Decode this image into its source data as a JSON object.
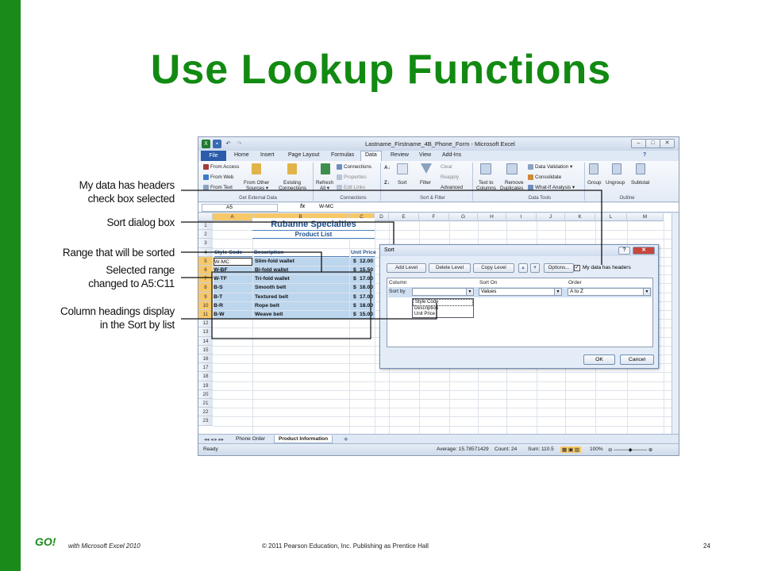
{
  "slide": {
    "title": "Use Lookup Functions",
    "footer_brand": "GO!",
    "footer_series": "with Microsoft Excel 2010",
    "footer_copyright": "© 2011 Pearson Education, Inc. Publishing as Prentice Hall",
    "page_number": "24"
  },
  "callouts": [
    {
      "line1": "My data has headers",
      "line2": "check box selected"
    },
    {
      "line1": "Sort dialog box",
      "line2": ""
    },
    {
      "line1": "Range that will be sorted",
      "line2": ""
    },
    {
      "line1": "Selected range",
      "line2": "changed to A5:C11"
    },
    {
      "line1": "Column headings display",
      "line2": "in the Sort by list"
    }
  ],
  "excel": {
    "window_title": "Lastname_Firstname_4B_Phone_Form - Microsoft Excel",
    "window_buttons": [
      "–",
      "□",
      "✕"
    ],
    "tabs": [
      "File",
      "Home",
      "Insert",
      "Page Layout",
      "Formulas",
      "Data",
      "Review",
      "View",
      "Add-Ins"
    ],
    "active_tab": "Data",
    "ribbon": {
      "get_external_data": {
        "label": "Get External Data",
        "from_access": "From Access",
        "from_web": "From Web",
        "from_text": "From Text",
        "from_other_1": "From Other",
        "from_other_2": "Sources ▾",
        "existing_1": "Existing",
        "existing_2": "Connections"
      },
      "connections": {
        "label": "Connections",
        "refresh_1": "Refresh",
        "refresh_2": "All ▾",
        "connections": "Connections",
        "properties": "Properties",
        "edit_links": "Edit Links"
      },
      "sort_filter": {
        "label": "Sort & Filter",
        "sort": "Sort",
        "filter": "Filter",
        "clear": "Clear",
        "reapply": "Reapply",
        "advanced": "Advanced"
      },
      "data_tools": {
        "label": "Data Tools",
        "text_to_1": "Text to",
        "text_to_2": "Columns",
        "remove_1": "Remove",
        "remove_2": "Duplicates",
        "validation": "Data Validation ▾",
        "consolidate": "Consolidate",
        "what_if": "What-If Analysis ▾"
      },
      "outline": {
        "label": "Outline",
        "group": "Group",
        "ungroup": "Ungroup",
        "subtotal": "Subtotal"
      }
    },
    "name_box": "A5",
    "fx": "fx",
    "formula_value": "W-MC",
    "columns": [
      "A",
      "B",
      "C",
      "D",
      "E",
      "F",
      "G",
      "H",
      "I",
      "J",
      "K",
      "L",
      "M"
    ],
    "rows": [
      "1",
      "2",
      "3",
      "4",
      "5",
      "6",
      "7",
      "8",
      "9",
      "10",
      "11",
      "12",
      "13",
      "14",
      "15",
      "16",
      "17",
      "18",
      "19",
      "20",
      "21",
      "22",
      "23"
    ],
    "sheet_title": "Rubanne Specialties",
    "sheet_subtitle": "Product List",
    "headers": {
      "code": "Style Code",
      "desc": "Description",
      "price": "Unit Price"
    },
    "data_rows": [
      {
        "code": "W-MC",
        "desc": "Slim-fold wallet",
        "cur": "$",
        "price": "12.00"
      },
      {
        "code": "W-BF",
        "desc": "Bi-fold wallet",
        "cur": "$",
        "price": "15.50"
      },
      {
        "code": "W-TF",
        "desc": "Tri-fold wallet",
        "cur": "$",
        "price": "17.00"
      },
      {
        "code": "B-S",
        "desc": "Smooth belt",
        "cur": "$",
        "price": "16.00"
      },
      {
        "code": "B-T",
        "desc": "Textured belt",
        "cur": "$",
        "price": "17.00"
      },
      {
        "code": "B-R",
        "desc": "Rope belt",
        "cur": "$",
        "price": "18.00"
      },
      {
        "code": "B-W",
        "desc": "Weave belt",
        "cur": "$",
        "price": "15.00"
      }
    ],
    "sheet_tabs": [
      "Phone Order",
      "Product Information"
    ],
    "active_sheet": "Product Information",
    "status": {
      "ready": "Ready",
      "average": "Average: 15.78571429",
      "count": "Count: 24",
      "sum": "Sum: 110.5",
      "zoom": "100%"
    }
  },
  "sort_dialog": {
    "title": "Sort",
    "help": "?",
    "close": "✕",
    "add_level": "Add Level",
    "delete_level": "Delete Level",
    "copy_level": "Copy Level",
    "options": "Options...",
    "headers_checkbox": "My data has headers",
    "headers_checked": true,
    "col_column": "Column",
    "col_sort_on": "Sort On",
    "col_order": "Order",
    "sort_by_label": "Sort by",
    "sort_by_value": "",
    "sort_on_value": "Values",
    "order_value": "A to Z",
    "dropdown_options": [
      "Style Code",
      "Description",
      "Unit Price"
    ],
    "ok": "OK",
    "cancel": "Cancel"
  }
}
